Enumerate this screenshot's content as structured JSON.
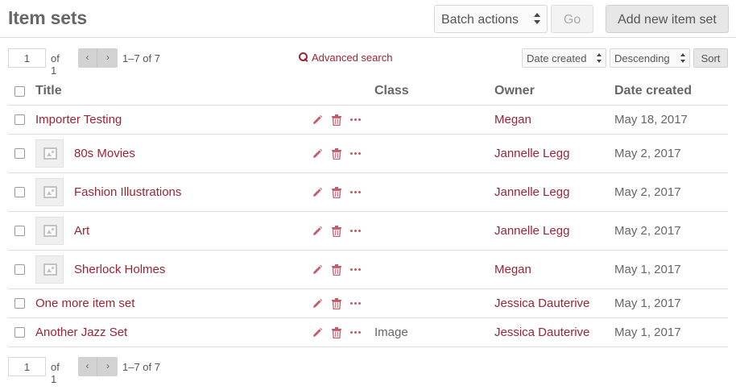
{
  "header": {
    "title": "Item sets",
    "batch_actions": "Batch actions",
    "go_label": "Go",
    "add_label": "Add new item set"
  },
  "pagination": {
    "page": "1",
    "of_pages": "of 1",
    "range": "1–7 of 7"
  },
  "search": {
    "advanced_label": "Advanced search"
  },
  "sort": {
    "by": "Date created",
    "order": "Descending",
    "button": "Sort"
  },
  "table": {
    "headers": {
      "title": "Title",
      "class": "Class",
      "owner": "Owner",
      "date": "Date created"
    },
    "rows": [
      {
        "title": "Importer Testing",
        "class": "",
        "owner": "Megan",
        "date": "May 18, 2017",
        "has_thumbnail": false
      },
      {
        "title": "80s Movies",
        "class": "",
        "owner": "Jannelle Legg",
        "date": "May 2, 2017",
        "has_thumbnail": true
      },
      {
        "title": "Fashion Illustrations",
        "class": "",
        "owner": "Jannelle Legg",
        "date": "May 2, 2017",
        "has_thumbnail": true
      },
      {
        "title": "Art",
        "class": "",
        "owner": "Jannelle Legg",
        "date": "May 2, 2017",
        "has_thumbnail": true
      },
      {
        "title": "Sherlock Holmes",
        "class": "",
        "owner": "Megan",
        "date": "May 1, 2017",
        "has_thumbnail": true
      },
      {
        "title": "One more item set",
        "class": "",
        "owner": "Jessica Dauterive",
        "date": "May 1, 2017",
        "has_thumbnail": false
      },
      {
        "title": "Another Jazz Set",
        "class": "Image",
        "owner": "Jessica Dauterive",
        "date": "May 1, 2017",
        "has_thumbnail": false
      }
    ]
  },
  "icons": {
    "edit": "pencil-icon",
    "delete": "trash-icon",
    "more": "more-actions-icon",
    "search": "search-icon",
    "thumbnail": "image-placeholder-icon"
  },
  "colors": {
    "link": "#9b2335",
    "action_icon": "#c45a68",
    "border": "#dfdfdf"
  }
}
